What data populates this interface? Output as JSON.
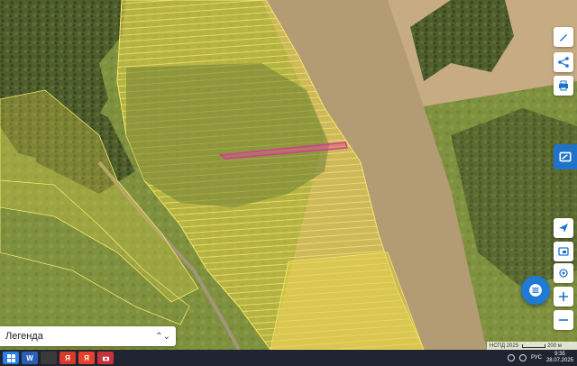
{
  "map": {
    "colors": {
      "field_bare": "#b49c74",
      "field_light": "#c9ad84",
      "forest": "#4a5a2a",
      "meadow": "#7c8d3e",
      "cadastral_fill": "#e3d14b",
      "cadastral_stroke": "#f4e86a",
      "selected_parcel": "#e0409a"
    },
    "legend": {
      "label": "Легенда"
    },
    "attribution": {
      "text": "НСПД 2025",
      "scale_label": "200 м"
    },
    "controls": [
      {
        "icon": "draw-icon"
      },
      {
        "icon": "share-icon"
      },
      {
        "icon": "print-icon"
      },
      {
        "icon": "layers-icon"
      },
      {
        "icon": "locate-icon"
      },
      {
        "icon": "screen-icon"
      },
      {
        "icon": "geolocation-icon"
      },
      {
        "icon": "zoom-in-icon"
      },
      {
        "icon": "zoom-out-icon"
      },
      {
        "icon": "menu-icon"
      }
    ]
  },
  "taskbar": {
    "apps": [
      {
        "icon": "windows-icon",
        "label": "",
        "color": "#2b7de9"
      },
      {
        "icon": "word-icon",
        "label": "W",
        "color": "#2b5fb5"
      },
      {
        "icon": "app-dark-icon",
        "label": "",
        "color": "#3a3a3a"
      },
      {
        "icon": "yandex-icon",
        "label": "Я",
        "color": "#d83a2a"
      },
      {
        "icon": "yandex-browser-icon",
        "label": "Я",
        "color": "#e6412d"
      },
      {
        "icon": "camera-icon",
        "label": "",
        "color": "#c8323c"
      }
    ],
    "tray": {
      "language": "РУС",
      "time": "9:35",
      "date": "28.07.2025"
    }
  }
}
